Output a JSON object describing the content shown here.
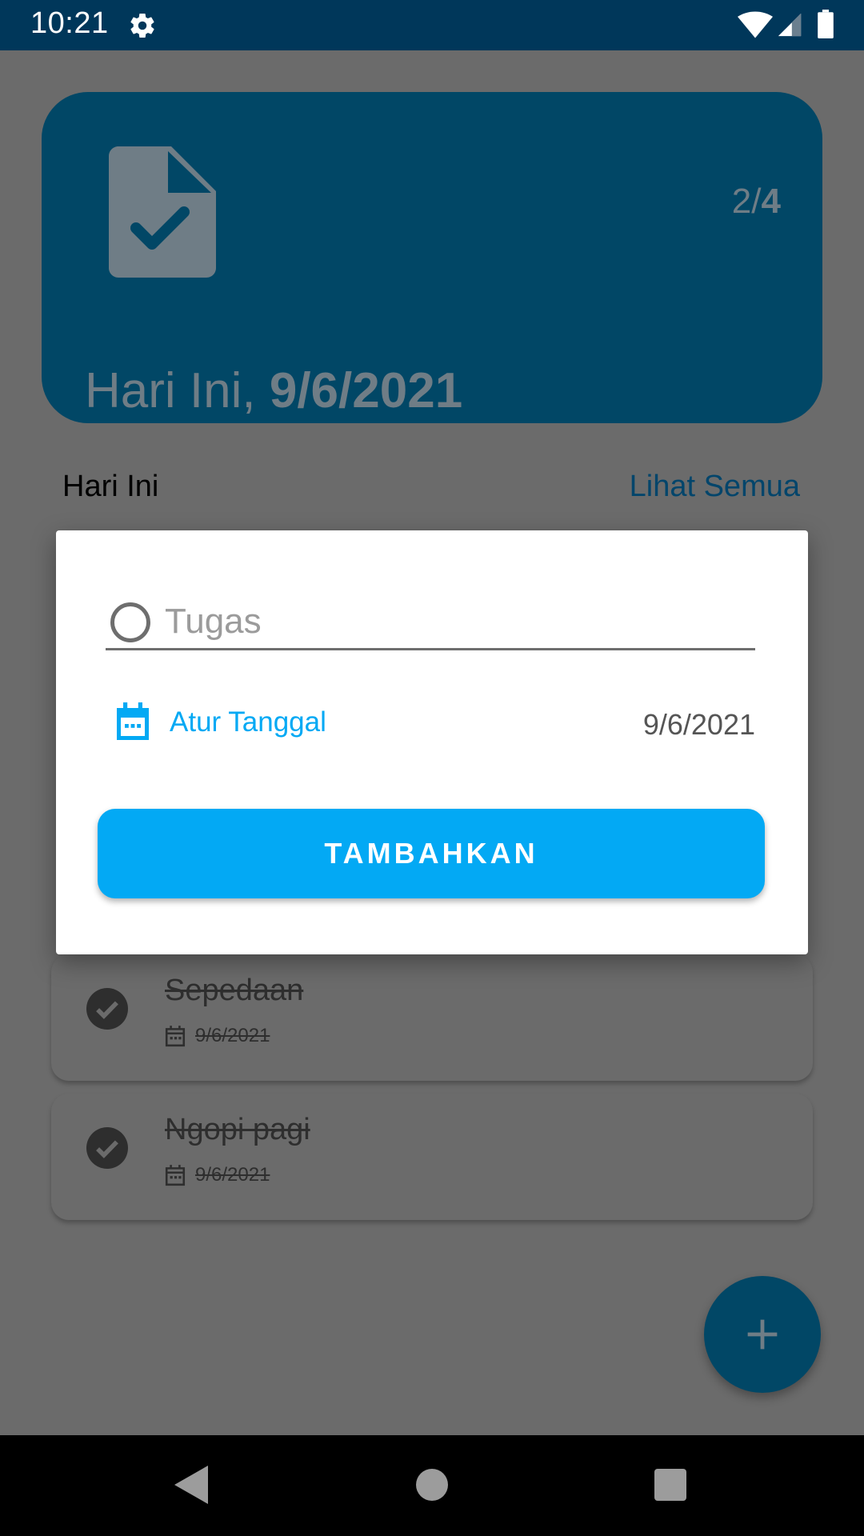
{
  "status_bar": {
    "time": "10:21",
    "icons": [
      "gear-icon",
      "wifi-icon",
      "signal-icon",
      "battery-icon"
    ]
  },
  "summary_card": {
    "icon": "document-check-icon",
    "completed": "2",
    "separator": "/",
    "total": "4",
    "date_prefix": "Hari Ini, ",
    "date": "9/6/2021"
  },
  "section": {
    "title": "Hari Ini",
    "see_all": "Lihat Semua"
  },
  "tasks": [
    {
      "title": "Sepedaan",
      "date": "9/6/2021",
      "done": true
    },
    {
      "title": "Ngopi pagi",
      "date": "9/6/2021",
      "done": true
    }
  ],
  "dialog": {
    "task_placeholder": "Tugas",
    "task_value": "",
    "set_date_label": "Atur Tanggal",
    "selected_date": "9/6/2021",
    "add_button": "TAMBAHKAN"
  },
  "fab": {
    "icon": "plus-icon"
  },
  "nav_bar": {
    "icons": [
      "back-icon",
      "home-icon",
      "recents-icon"
    ]
  },
  "colors": {
    "status_bar": "#00375a",
    "card": "#014766",
    "accent": "#03a9f4",
    "scrim_bg": "#6b6b6b"
  }
}
